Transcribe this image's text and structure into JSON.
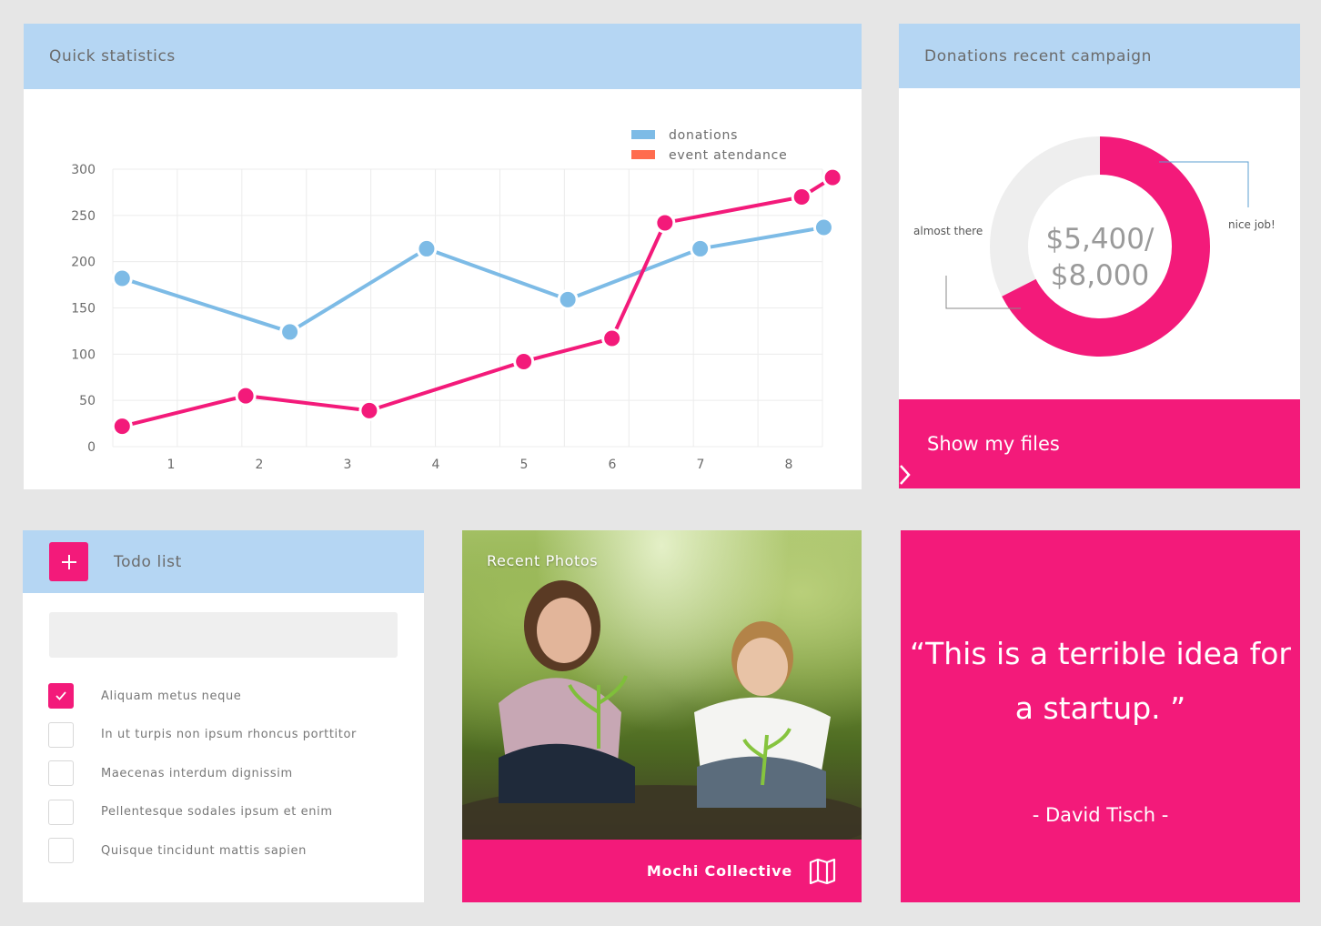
{
  "stats": {
    "title": "Quick statistics",
    "legend": [
      {
        "label": "donations",
        "color": "#7dbbe6"
      },
      {
        "label": "event atendance",
        "color": "#ff6c4f"
      }
    ]
  },
  "chart_data": {
    "type": "line",
    "categories": [
      "1",
      "2",
      "3",
      "4",
      "5",
      "6",
      "7",
      "8"
    ],
    "y_ticks": [
      "0",
      "50",
      "100",
      "150",
      "200",
      "250",
      "300"
    ],
    "ylim": [
      0,
      300
    ],
    "grid": true,
    "legend_position": "top-right",
    "series": [
      {
        "name": "donations",
        "color": "#7dbbe6",
        "points": [
          {
            "x": 0.4,
            "y": 182
          },
          {
            "x": 2.3,
            "y": 124
          },
          {
            "x": 3.85,
            "y": 214
          },
          {
            "x": 5.45,
            "y": 159
          },
          {
            "x": 6.95,
            "y": 214
          },
          {
            "x": 8.35,
            "y": 237
          }
        ]
      },
      {
        "name": "event atendance",
        "color": "#f31a7a",
        "points": [
          {
            "x": 0.4,
            "y": 22
          },
          {
            "x": 1.8,
            "y": 55
          },
          {
            "x": 3.2,
            "y": 39
          },
          {
            "x": 4.95,
            "y": 92
          },
          {
            "x": 5.95,
            "y": 117
          },
          {
            "x": 6.55,
            "y": 242
          },
          {
            "x": 8.1,
            "y": 270
          },
          {
            "x": 8.45,
            "y": 291
          }
        ]
      }
    ]
  },
  "donations": {
    "title": "Donations recent campaign",
    "amount_line1": "$5,400/",
    "amount_line2": "$8,000",
    "raised": 5400,
    "goal": 8000,
    "progress_color": "#f31a7a",
    "track_color": "#eeeeee",
    "label_left": "almost there",
    "label_right": "nice job!",
    "button_label": "Show my files"
  },
  "todo": {
    "title": "Todo list",
    "input_value": "",
    "items": [
      {
        "text": "Aliquam metus neque",
        "checked": true
      },
      {
        "text": "In ut turpis non ipsum rhoncus porttitor",
        "checked": false
      },
      {
        "text": "Maecenas interdum dignissim",
        "checked": false
      },
      {
        "text": "Pellentesque sodales ipsum et enim",
        "checked": false
      },
      {
        "text": "Quisque tincidunt mattis sapien",
        "checked": false
      }
    ]
  },
  "photos": {
    "title": "Recent Photos",
    "footer_label": "Mochi Collective",
    "icon": "map-icon"
  },
  "quote": {
    "text": "“This is a terrible idea for a startup. ”",
    "author": "- David Tisch -"
  },
  "colors": {
    "accent": "#f31a7a",
    "header": "#b5d6f3",
    "background": "#e6e6e6"
  }
}
